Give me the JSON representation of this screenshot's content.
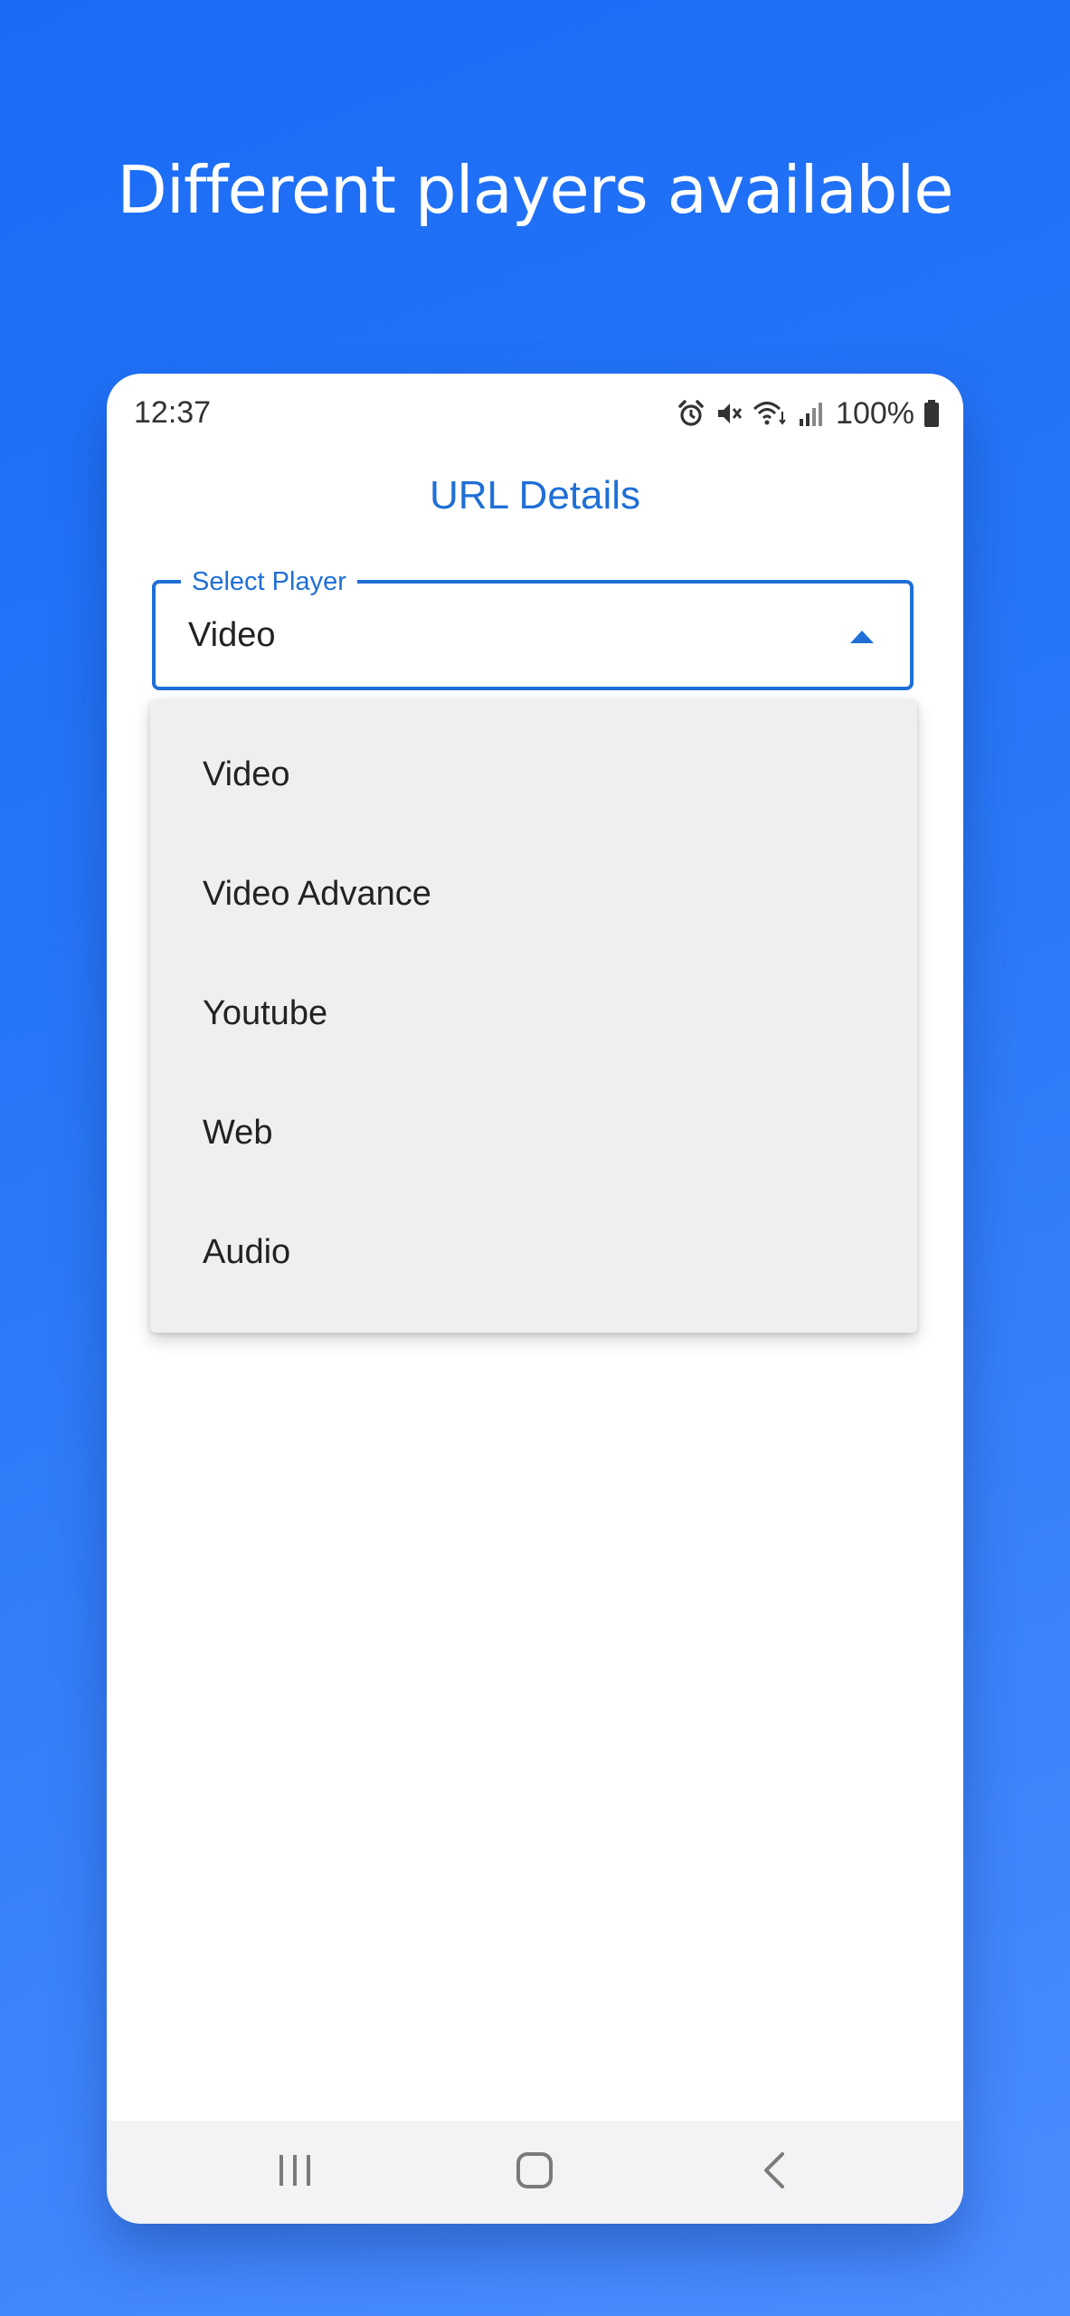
{
  "promo": {
    "headline": "Different players available"
  },
  "status_bar": {
    "time": "12:37",
    "battery": "100%",
    "icons": [
      "alarm-icon",
      "mute-icon",
      "wifi-icon",
      "signal-icon",
      "battery-icon"
    ]
  },
  "screen": {
    "title": "URL Details"
  },
  "player_select": {
    "label": "Select Player",
    "value": "Video",
    "expanded": true,
    "options": [
      "Video",
      "Video Advance",
      "Youtube",
      "Web",
      "Audio"
    ]
  },
  "nav_bar": {
    "icons": [
      "recent-apps-icon",
      "home-icon",
      "back-icon"
    ]
  },
  "colors": {
    "accent": "#1f6fd6",
    "background_gradient_start": "#1a6cf6",
    "background_gradient_end": "#4a8cff",
    "menu_background": "#efeff0",
    "nav_background": "#f3f3f5"
  }
}
